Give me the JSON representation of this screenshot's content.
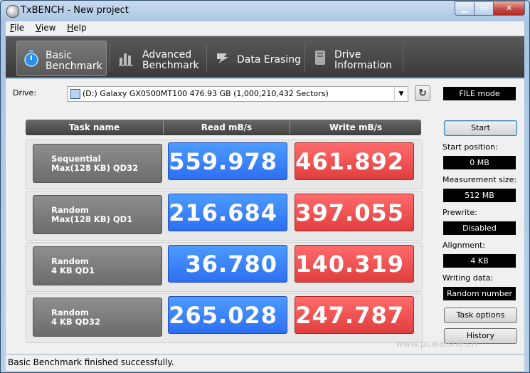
{
  "window": {
    "title": "TxBENCH - New project",
    "controls": [
      "minimize",
      "maximize",
      "close"
    ]
  },
  "menu": [
    "File",
    "View",
    "Help"
  ],
  "tabs": [
    {
      "line1": "Basic",
      "line2": "Benchmark",
      "icon": "stopwatch-icon",
      "active": true
    },
    {
      "line1": "Advanced",
      "line2": "Benchmark",
      "icon": "bar-chart-icon",
      "active": false
    },
    {
      "line1": "Data Erasing",
      "line2": "",
      "icon": "eraser-icon",
      "active": false
    },
    {
      "line1": "Drive",
      "line2": "Information",
      "icon": "drive-icon",
      "active": false
    }
  ],
  "drive": {
    "label": "Drive:",
    "selected": "(D:) Galaxy GX0500MT100  476.93 GB (1,000,210,432 Sectors)"
  },
  "mode_badge": "FILE mode",
  "table": {
    "headers": [
      "Task name",
      "Read mB/s",
      "Write mB/s"
    ],
    "rows": [
      {
        "line1": "Sequential",
        "line2": "Max(128 KB) QD32",
        "read": "559.978",
        "write": "461.892"
      },
      {
        "line1": "Random",
        "line2": "Max(128 KB) QD1",
        "read": "216.684",
        "write": "397.055"
      },
      {
        "line1": "Random",
        "line2": "4 KB QD1",
        "read": "36.780",
        "write": "140.319"
      },
      {
        "line1": "Random",
        "line2": "4 KB QD32",
        "read": "265.028",
        "write": "247.787"
      }
    ]
  },
  "side": {
    "start_label": "Start",
    "start_position_label": "Start position:",
    "start_position_value": "0 MB",
    "measurement_size_label": "Measurement size:",
    "measurement_size_value": "512 MB",
    "prewrite_label": "Prewrite:",
    "prewrite_value": "Disabled",
    "alignment_label": "Alignment:",
    "alignment_value": "4 KB",
    "writing_data_label": "Writing data:",
    "writing_data_value": "Random number",
    "task_options_label": "Task options",
    "history_label": "History"
  },
  "status": "Basic Benchmark finished successfully.",
  "watermark": "www.pcwaishe.cn",
  "colors": {
    "read": "#2d6ff2",
    "write": "#e03e3e",
    "toolbar": "#3a3a3a"
  }
}
